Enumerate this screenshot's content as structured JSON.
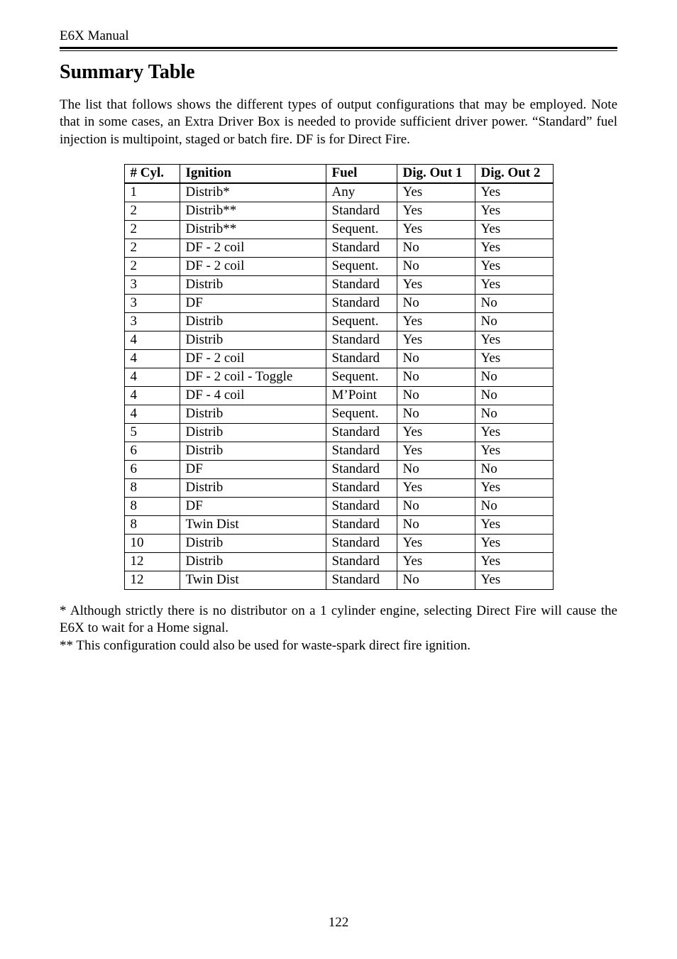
{
  "header": {
    "running_head": "E6X Manual"
  },
  "title": "Summary Table",
  "intro": "The list that follows shows the different types of output configurations that may be employed. Note that in some cases, an Extra Driver Box is needed to provide sufficient driver power. “Standard” fuel injection is multipoint, staged or batch fire. DF is for Direct Fire.",
  "footnote1": "* Although strictly there is no distributor on a 1 cylinder engine, selecting Direct Fire will cause the E6X to wait for a Home signal.",
  "footnote2": "** This configuration could also be used for waste-spark direct fire ignition.",
  "page_number": "122",
  "chart_data": {
    "type": "table",
    "headers": [
      "# Cyl.",
      "Ignition",
      "Fuel",
      "Dig. Out 1",
      "Dig. Out 2"
    ],
    "rows": [
      [
        "1",
        "Distrib*",
        "Any",
        "Yes",
        "Yes"
      ],
      [
        "2",
        "Distrib**",
        "Standard",
        "Yes",
        "Yes"
      ],
      [
        "2",
        "Distrib**",
        "Sequent.",
        "Yes",
        "Yes"
      ],
      [
        "2",
        "DF - 2 coil",
        "Standard",
        "No",
        "Yes"
      ],
      [
        "2",
        "DF - 2 coil",
        "Sequent.",
        "No",
        "Yes"
      ],
      [
        "3",
        "Distrib",
        "Standard",
        "Yes",
        "Yes"
      ],
      [
        "3",
        "DF",
        "Standard",
        "No",
        "No"
      ],
      [
        "3",
        "Distrib",
        "Sequent.",
        "Yes",
        "No"
      ],
      [
        "4",
        "Distrib",
        "Standard",
        "Yes",
        "Yes"
      ],
      [
        "4",
        "DF - 2 coil",
        "Standard",
        "No",
        "Yes"
      ],
      [
        "4",
        "DF - 2 coil - Toggle",
        "Sequent.",
        "No",
        "No"
      ],
      [
        "4",
        "DF - 4 coil",
        "M’Point",
        "No",
        "No"
      ],
      [
        "4",
        "Distrib",
        "Sequent.",
        "No",
        "No"
      ],
      [
        "5",
        "Distrib",
        "Standard",
        "Yes",
        "Yes"
      ],
      [
        "6",
        "Distrib",
        "Standard",
        "Yes",
        "Yes"
      ],
      [
        "6",
        "DF",
        "Standard",
        "No",
        "No"
      ],
      [
        "8",
        "Distrib",
        "Standard",
        "Yes",
        "Yes"
      ],
      [
        "8",
        "DF",
        "Standard",
        "No",
        "No"
      ],
      [
        "8",
        "Twin Dist",
        "Standard",
        "No",
        "Yes"
      ],
      [
        "10",
        "Distrib",
        "Standard",
        "Yes",
        "Yes"
      ],
      [
        "12",
        "Distrib",
        "Standard",
        "Yes",
        "Yes"
      ],
      [
        "12",
        "Twin Dist",
        "Standard",
        "No",
        "Yes"
      ]
    ]
  }
}
